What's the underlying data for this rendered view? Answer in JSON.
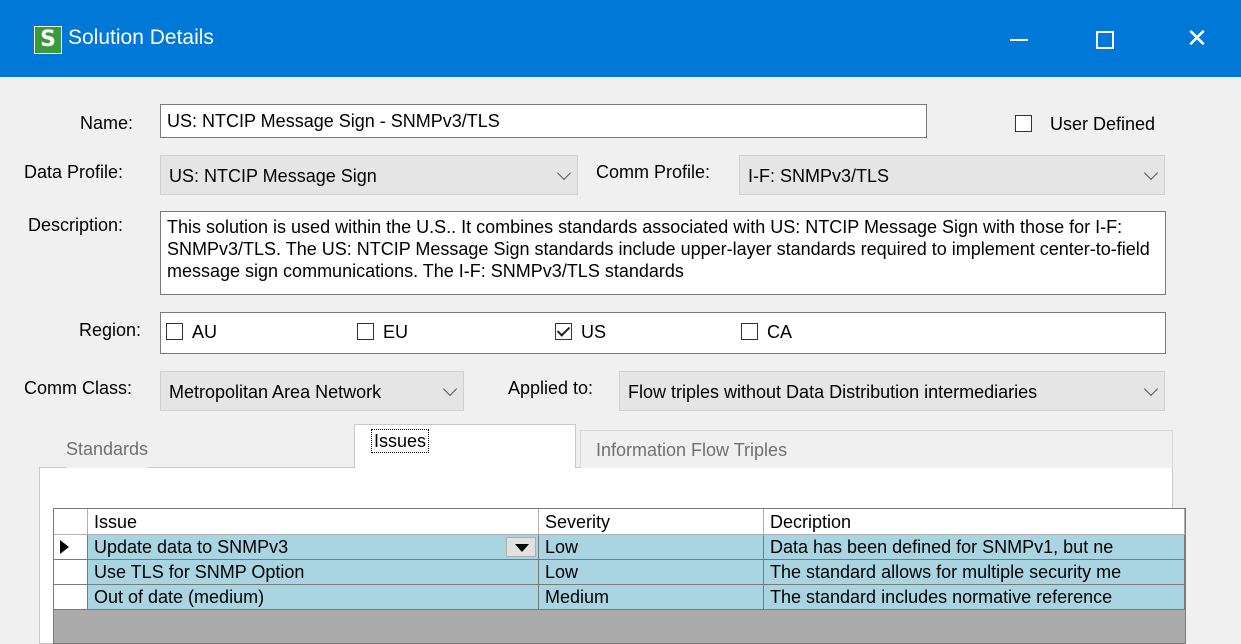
{
  "window": {
    "app_icon": "S",
    "title": "Solution Details"
  },
  "form": {
    "name_label": "Name:",
    "name_value": "US: NTCIP Message Sign -  SNMPv3/TLS",
    "user_defined_label": "User Defined",
    "user_defined_checked": false,
    "data_profile_label": "Data Profile:",
    "data_profile_value": "US: NTCIP Message Sign",
    "comm_profile_label": "Comm Profile:",
    "comm_profile_value": "I-F: SNMPv3/TLS",
    "description_label": "Description:",
    "description_value": "This solution is used within the U.S..  It combines standards associated with US: NTCIP Message Sign with those for I-F: SNMPv3/TLS. The US: NTCIP Message Sign standards include upper-layer standards required to implement center-to-field message sign communications.  The I-F: SNMPv3/TLS standards",
    "region_label": "Region:",
    "regions": [
      {
        "label": "AU",
        "checked": false
      },
      {
        "label": "EU",
        "checked": false
      },
      {
        "label": "US",
        "checked": true
      },
      {
        "label": "CA",
        "checked": false
      }
    ],
    "comm_class_label": "Comm Class:",
    "comm_class_value": "Metropolitan Area Network",
    "applied_to_label": "Applied to:",
    "applied_to_value": "Flow triples without Data Distribution intermediaries"
  },
  "tabs": [
    {
      "label": "Standards",
      "active": false
    },
    {
      "label": "Issues",
      "active": true
    },
    {
      "label": "Information Flow Triples",
      "active": false
    }
  ],
  "issues_table": {
    "columns": [
      "Issue",
      "Severity",
      "Decription"
    ],
    "rows": [
      {
        "issue": "Update data to SNMPv3",
        "severity": "Low",
        "description": "Data has been defined for SNMPv1, but ne",
        "current": true
      },
      {
        "issue": "Use TLS for SNMP Option",
        "severity": "Low",
        "description": "The standard allows for multiple security me",
        "current": false
      },
      {
        "issue": "Out of date (medium)",
        "severity": "Medium",
        "description": "The standard includes normative reference",
        "current": false
      }
    ]
  },
  "colors": {
    "titlebar": "#0078d7",
    "row_highlight": "#a9d5e2",
    "grid_background": "#ababab"
  }
}
